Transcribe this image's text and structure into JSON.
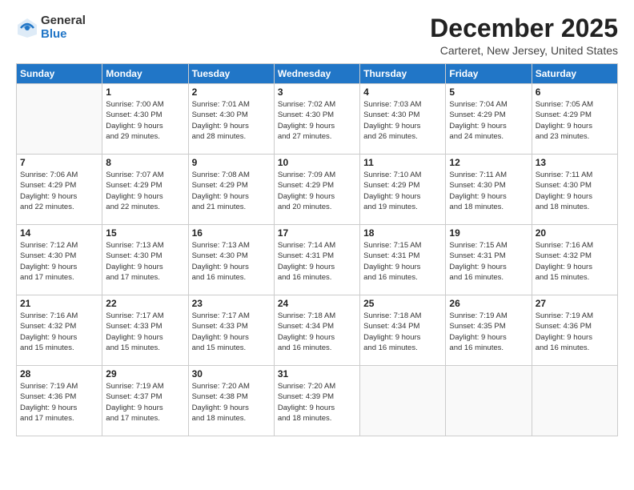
{
  "logo": {
    "general": "General",
    "blue": "Blue"
  },
  "title": "December 2025",
  "subtitle": "Carteret, New Jersey, United States",
  "header_days": [
    "Sunday",
    "Monday",
    "Tuesday",
    "Wednesday",
    "Thursday",
    "Friday",
    "Saturday"
  ],
  "weeks": [
    [
      {
        "day": "",
        "info": ""
      },
      {
        "day": "1",
        "info": "Sunrise: 7:00 AM\nSunset: 4:30 PM\nDaylight: 9 hours\nand 29 minutes."
      },
      {
        "day": "2",
        "info": "Sunrise: 7:01 AM\nSunset: 4:30 PM\nDaylight: 9 hours\nand 28 minutes."
      },
      {
        "day": "3",
        "info": "Sunrise: 7:02 AM\nSunset: 4:30 PM\nDaylight: 9 hours\nand 27 minutes."
      },
      {
        "day": "4",
        "info": "Sunrise: 7:03 AM\nSunset: 4:30 PM\nDaylight: 9 hours\nand 26 minutes."
      },
      {
        "day": "5",
        "info": "Sunrise: 7:04 AM\nSunset: 4:29 PM\nDaylight: 9 hours\nand 24 minutes."
      },
      {
        "day": "6",
        "info": "Sunrise: 7:05 AM\nSunset: 4:29 PM\nDaylight: 9 hours\nand 23 minutes."
      }
    ],
    [
      {
        "day": "7",
        "info": "Sunrise: 7:06 AM\nSunset: 4:29 PM\nDaylight: 9 hours\nand 22 minutes."
      },
      {
        "day": "8",
        "info": "Sunrise: 7:07 AM\nSunset: 4:29 PM\nDaylight: 9 hours\nand 22 minutes."
      },
      {
        "day": "9",
        "info": "Sunrise: 7:08 AM\nSunset: 4:29 PM\nDaylight: 9 hours\nand 21 minutes."
      },
      {
        "day": "10",
        "info": "Sunrise: 7:09 AM\nSunset: 4:29 PM\nDaylight: 9 hours\nand 20 minutes."
      },
      {
        "day": "11",
        "info": "Sunrise: 7:10 AM\nSunset: 4:29 PM\nDaylight: 9 hours\nand 19 minutes."
      },
      {
        "day": "12",
        "info": "Sunrise: 7:11 AM\nSunset: 4:30 PM\nDaylight: 9 hours\nand 18 minutes."
      },
      {
        "day": "13",
        "info": "Sunrise: 7:11 AM\nSunset: 4:30 PM\nDaylight: 9 hours\nand 18 minutes."
      }
    ],
    [
      {
        "day": "14",
        "info": "Sunrise: 7:12 AM\nSunset: 4:30 PM\nDaylight: 9 hours\nand 17 minutes."
      },
      {
        "day": "15",
        "info": "Sunrise: 7:13 AM\nSunset: 4:30 PM\nDaylight: 9 hours\nand 17 minutes."
      },
      {
        "day": "16",
        "info": "Sunrise: 7:13 AM\nSunset: 4:30 PM\nDaylight: 9 hours\nand 16 minutes."
      },
      {
        "day": "17",
        "info": "Sunrise: 7:14 AM\nSunset: 4:31 PM\nDaylight: 9 hours\nand 16 minutes."
      },
      {
        "day": "18",
        "info": "Sunrise: 7:15 AM\nSunset: 4:31 PM\nDaylight: 9 hours\nand 16 minutes."
      },
      {
        "day": "19",
        "info": "Sunrise: 7:15 AM\nSunset: 4:31 PM\nDaylight: 9 hours\nand 16 minutes."
      },
      {
        "day": "20",
        "info": "Sunrise: 7:16 AM\nSunset: 4:32 PM\nDaylight: 9 hours\nand 15 minutes."
      }
    ],
    [
      {
        "day": "21",
        "info": "Sunrise: 7:16 AM\nSunset: 4:32 PM\nDaylight: 9 hours\nand 15 minutes."
      },
      {
        "day": "22",
        "info": "Sunrise: 7:17 AM\nSunset: 4:33 PM\nDaylight: 9 hours\nand 15 minutes."
      },
      {
        "day": "23",
        "info": "Sunrise: 7:17 AM\nSunset: 4:33 PM\nDaylight: 9 hours\nand 15 minutes."
      },
      {
        "day": "24",
        "info": "Sunrise: 7:18 AM\nSunset: 4:34 PM\nDaylight: 9 hours\nand 16 minutes."
      },
      {
        "day": "25",
        "info": "Sunrise: 7:18 AM\nSunset: 4:34 PM\nDaylight: 9 hours\nand 16 minutes."
      },
      {
        "day": "26",
        "info": "Sunrise: 7:19 AM\nSunset: 4:35 PM\nDaylight: 9 hours\nand 16 minutes."
      },
      {
        "day": "27",
        "info": "Sunrise: 7:19 AM\nSunset: 4:36 PM\nDaylight: 9 hours\nand 16 minutes."
      }
    ],
    [
      {
        "day": "28",
        "info": "Sunrise: 7:19 AM\nSunset: 4:36 PM\nDaylight: 9 hours\nand 17 minutes."
      },
      {
        "day": "29",
        "info": "Sunrise: 7:19 AM\nSunset: 4:37 PM\nDaylight: 9 hours\nand 17 minutes."
      },
      {
        "day": "30",
        "info": "Sunrise: 7:20 AM\nSunset: 4:38 PM\nDaylight: 9 hours\nand 18 minutes."
      },
      {
        "day": "31",
        "info": "Sunrise: 7:20 AM\nSunset: 4:39 PM\nDaylight: 9 hours\nand 18 minutes."
      },
      {
        "day": "",
        "info": ""
      },
      {
        "day": "",
        "info": ""
      },
      {
        "day": "",
        "info": ""
      }
    ]
  ]
}
